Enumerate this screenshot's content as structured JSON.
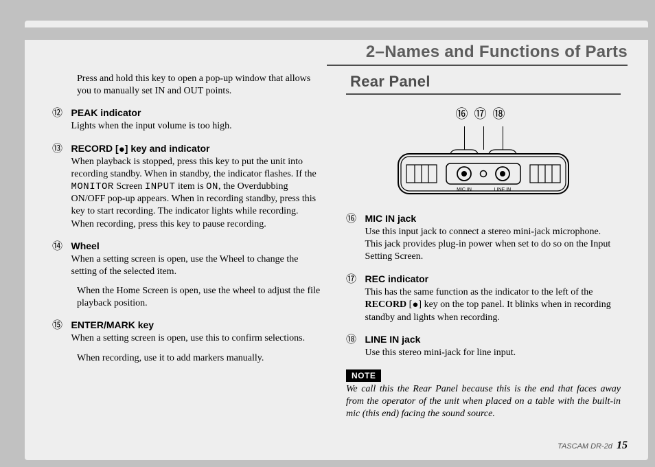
{
  "section_title": "2–Names and Functions of Parts",
  "left": {
    "intro": "Press and hold this key to open a pop-up window that allows you to manually set IN and OUT points.",
    "items": [
      {
        "num": "⑫",
        "title": "PEAK indicator",
        "text": "Lights when the input volume is too high."
      },
      {
        "num": "⑬",
        "title": "RECORD [●] key and indicator",
        "text_pre": "When playback is stopped, press this key to put the unit into recording standby. When in standby, the indicator flashes. If the ",
        "lcd1": "MONITOR",
        "text_mid1": " Screen ",
        "lcd2": "INPUT",
        "text_mid2": " item is ",
        "lcd3": "ON",
        "text_post": ", the Overdubbing ON/OFF pop-up appears. When in recording standby, press this key to start recording. The indicator lights while recording. When recording, press this key to pause recording."
      },
      {
        "num": "⑭",
        "title": "Wheel",
        "text": "When a setting screen is open, use the Wheel to change the setting of the selected item.",
        "para2": "When the Home Screen is open, use the wheel to adjust the file playback position."
      },
      {
        "num": "⑮",
        "title": "ENTER/MARK key",
        "text": "When a setting screen is open, use this to confirm selections.",
        "para2": "When recording, use it to add markers manually."
      }
    ]
  },
  "right": {
    "sub_title": "Rear Panel",
    "callouts": [
      "⑯",
      "⑰",
      "⑱"
    ],
    "jack_labels": {
      "mic": "MIC IN",
      "line": "LINE IN"
    },
    "items": [
      {
        "num": "⑯",
        "title": "MIC IN jack",
        "text": "Use this input jack to connect a stereo mini-jack microphone. This jack provides plug-in power when set to do so on the Input Setting Screen."
      },
      {
        "num": "⑰",
        "title": "REC indicator",
        "text_pre": "This has the same function as the indicator to the left of the ",
        "bold": "RECORD",
        "text_post": " [●] key on the top panel. It blinks when in recording standby and lights when recording."
      },
      {
        "num": "⑱",
        "title": "LINE IN jack",
        "text": "Use this stereo mini-jack for line input."
      }
    ],
    "note_label": "NOTE",
    "note_text": "We call this the Rear Panel because this is the end that faces away from the operator of the unit when placed on a table with the built-in mic (this end) facing the sound source."
  },
  "footer_model": "TASCAM  DR-2d",
  "footer_page": "15"
}
